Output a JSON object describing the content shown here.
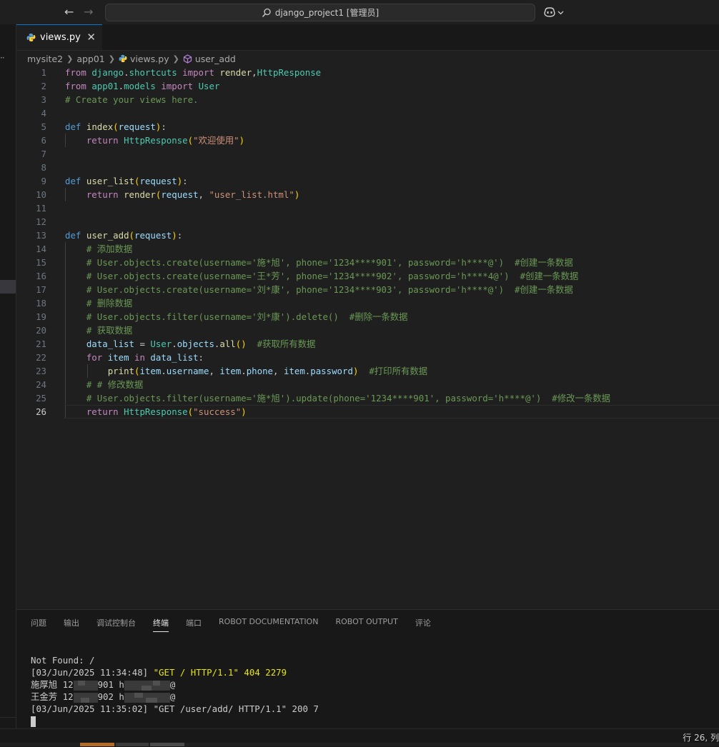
{
  "window": {
    "title": "django_project1 [管理员]"
  },
  "tab": {
    "label": "views.py",
    "close": "✕"
  },
  "breadcrumb": {
    "items": [
      "mysite2",
      "app01",
      "views.py",
      "user_add"
    ]
  },
  "editor": {
    "current_line": 26,
    "lines": [
      {
        "n": "1",
        "t": "from django.shortcuts import render,HttpResponse"
      },
      {
        "n": "2",
        "t": "from app01.models import User"
      },
      {
        "n": "3",
        "t": "# Create your views here."
      },
      {
        "n": "4",
        "t": ""
      },
      {
        "n": "5",
        "t": "def index(request):"
      },
      {
        "n": "6",
        "t": "    return HttpResponse(\"欢迎使用\")"
      },
      {
        "n": "7",
        "t": ""
      },
      {
        "n": "8",
        "t": ""
      },
      {
        "n": "9",
        "t": "def user_list(request):"
      },
      {
        "n": "10",
        "t": "    return render(request, \"user_list.html\")"
      },
      {
        "n": "11",
        "t": ""
      },
      {
        "n": "12",
        "t": ""
      },
      {
        "n": "13",
        "t": "def user_add(request):"
      },
      {
        "n": "14",
        "t": "    # 添加数据"
      },
      {
        "n": "15",
        "t": "    # User.objects.create(username='施*旭', phone='1234****901', password='h****@')  #创建一条数据"
      },
      {
        "n": "16",
        "t": "    # User.objects.create(username='王*芳', phone='1234****902', password='h****4@')  #创建一条数据"
      },
      {
        "n": "17",
        "t": "    # User.objects.create(username='刘*康', phone='1234****903', password='h****@')  #创建一条数据"
      },
      {
        "n": "18",
        "t": "    # 删除数据"
      },
      {
        "n": "19",
        "t": "    # User.objects.filter(username='刘*康').delete()  #删除一条数据"
      },
      {
        "n": "20",
        "t": "    # 获取数据"
      },
      {
        "n": "21",
        "t": "    data_list = User.objects.all()  #获取所有数据"
      },
      {
        "n": "22",
        "t": "    for item in data_list:"
      },
      {
        "n": "23",
        "t": "        print(item.username, item.phone, item.password)  #打印所有数据"
      },
      {
        "n": "24",
        "t": "    # # 修改数据"
      },
      {
        "n": "25",
        "t": "    # User.objects.filter(username='施*旭').update(phone='1234****901', password='h****@')  #修改一条数据"
      },
      {
        "n": "26",
        "t": "    return HttpResponse(\"success\")"
      }
    ]
  },
  "panel": {
    "tabs": [
      "问题",
      "输出",
      "调试控制台",
      "终端",
      "端口",
      "ROBOT DOCUMENTATION",
      "ROBOT OUTPUT",
      "评论"
    ],
    "active_tab": "终端"
  },
  "terminal": {
    "line1": "Not Found: /",
    "line2_time": "[03/Jun/2025 11:34:48] ",
    "line2_req": "\"GET / HTTP/1.1\" 404 2279",
    "row1_name": "施厚旭 12",
    "row1_phone_end": "901 h",
    "row1_pass_end": "@",
    "row2_name": "王金芳 12",
    "row2_phone_end": "902 h",
    "row2_pass_end": "@",
    "line5": "[03/Jun/2025 11:35:02] \"GET /user/add/ HTTP/1.1\" 200 7"
  },
  "status": {
    "position": "行 26, 列"
  },
  "colors": {
    "accent": "#0078d4",
    "background": "#1f1f1f",
    "keyword": "#569cd6",
    "control": "#c586c0",
    "function": "#dcdcaa",
    "string": "#ce9178",
    "comment": "#6a9955",
    "terminal_yellow": "#e5e510"
  },
  "icons": [
    "arrow-left-icon",
    "arrow-right-icon",
    "search-icon",
    "copilot-icon",
    "chevron-down-icon",
    "python-file-icon",
    "symbol-method-icon",
    "close-icon",
    "more-icon"
  ]
}
